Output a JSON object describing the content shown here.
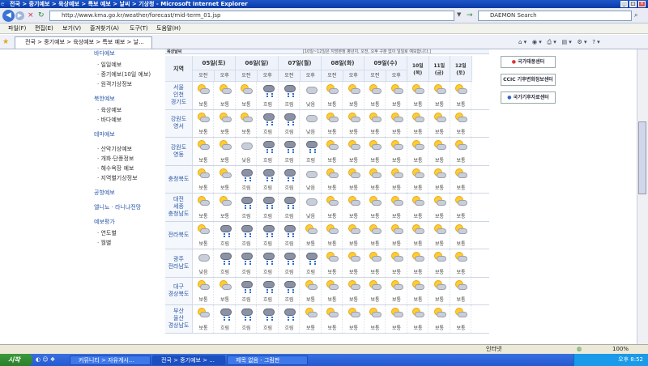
{
  "window": {
    "title": "전국 > 중기예보 > 육상예보 > 특보 예보 > 날씨 > 기상청 - Microsoft Internet Explorer"
  },
  "address": {
    "url": "http://www.kma.go.kr/weather/forecast/mid-term_01.jsp",
    "search_placeholder": "DAEMON Search"
  },
  "menu": [
    "파일(F)",
    "편집(E)",
    "보기(V)",
    "즐겨찾기(A)",
    "도구(T)",
    "도움말(H)"
  ],
  "tab": {
    "label": "전국 > 중기예보 > 육상예보 > 특보 예보 > 날..."
  },
  "sidebar": {
    "sections": [
      {
        "heading": "바다예보",
        "items": [
          "일일예보",
          "중기예보(10일 예보)",
          "원격기상정보"
        ]
      },
      {
        "heading": "북한예보",
        "items": [
          "육상예보",
          "바다예보"
        ]
      },
      {
        "heading": "테마예보",
        "items": [
          "산악기상예보",
          "개화·단풍정보",
          "해수욕장 예보",
          "지역별기상정보"
        ]
      },
      {
        "heading": "공항예보",
        "items": []
      },
      {
        "heading": "엘니뇨 · 라니냐전망",
        "items": []
      },
      {
        "heading": "예보평가",
        "items": [
          "연도별",
          "월별"
        ]
      }
    ]
  },
  "forecast": {
    "section_title": "육상날씨",
    "note": "[10일~12일은 지방본청 평년치, 오전, 오후 구분 없이 일일로 예보합니다.]",
    "region_header": "지역",
    "days": [
      {
        "date": "05일(토)",
        "split": true
      },
      {
        "date": "06일(일)",
        "split": true
      },
      {
        "date": "07일(월)",
        "split": true
      },
      {
        "date": "08일(화)",
        "split": true
      },
      {
        "date": "09일(수)",
        "split": true
      },
      {
        "date": "10일(목)",
        "split": false
      },
      {
        "date": "11일(금)",
        "split": false
      },
      {
        "date": "12일(토)",
        "split": false
      }
    ],
    "am": "오전",
    "pm": "오후",
    "rows": [
      {
        "region": "서울\n인천\n경기도",
        "cells": [
          "보통",
          "보통",
          "보통",
          "흐림",
          "흐림",
          "낮음",
          "보통",
          "보통",
          "보통",
          "보통",
          "보통",
          "보통",
          "보통"
        ]
      },
      {
        "region": "강원도\n영서",
        "cells": [
          "보통",
          "보통",
          "보통",
          "흐림",
          "흐림",
          "낮음",
          "보통",
          "보통",
          "보통",
          "보통",
          "보통",
          "보통",
          "보통"
        ]
      },
      {
        "region": "강원도\n영동",
        "cells": [
          "보통",
          "보통",
          "낮음",
          "흐림",
          "흐림",
          "흐림",
          "보통",
          "보통",
          "보통",
          "보통",
          "보통",
          "보통",
          "보통"
        ]
      },
      {
        "region": "충청북도",
        "cells": [
          "보통",
          "보통",
          "흐림",
          "흐림",
          "흐림",
          "낮음",
          "보통",
          "보통",
          "보통",
          "보통",
          "보통",
          "보통",
          "보통"
        ]
      },
      {
        "region": "대전\n세종\n충청남도",
        "cells": [
          "보통",
          "보통",
          "흐림",
          "흐림",
          "흐림",
          "낮음",
          "보통",
          "보통",
          "보통",
          "보통",
          "보통",
          "보통",
          "보통"
        ]
      },
      {
        "region": "전라북도",
        "cells": [
          "보통",
          "흐림",
          "흐림",
          "흐림",
          "흐림",
          "보통",
          "보통",
          "보통",
          "보통",
          "보통",
          "보통",
          "보통",
          "보통"
        ]
      },
      {
        "region": "광주\n전라남도",
        "cells": [
          "낮음",
          "흐림",
          "흐림",
          "흐림",
          "흐림",
          "흐림",
          "보통",
          "보통",
          "보통",
          "보통",
          "보통",
          "보통",
          "보통"
        ]
      },
      {
        "region": "대구\n경상북도",
        "cells": [
          "보통",
          "보통",
          "흐림",
          "흐림",
          "흐림",
          "보통",
          "보통",
          "보통",
          "보통",
          "보통",
          "보통",
          "보통",
          "보통"
        ]
      },
      {
        "region": "부산\n울산\n경상남도",
        "cells": [
          "보통",
          "흐림",
          "흐림",
          "흐림",
          "흐림",
          "보통",
          "보통",
          "보통",
          "보통",
          "보통",
          "보통",
          "보통",
          "보통"
        ]
      }
    ]
  },
  "right_links": [
    "국가태풍센터",
    "CCIC 기후변화정보센터",
    "국가기후자료센터"
  ],
  "status": {
    "zone": "인터넷",
    "zoom": "100%"
  },
  "taskbar": {
    "start": "시작",
    "tasks": [
      "커뮤니티 > 자유게시...",
      "전국 > 중기예보 > ...",
      "제목 없음 - 그림판"
    ],
    "clock": "오후 8:52"
  }
}
